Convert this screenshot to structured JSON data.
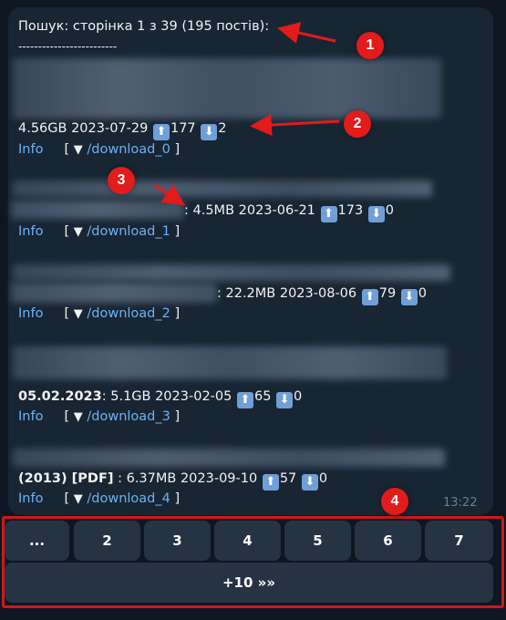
{
  "message": {
    "header": "Пошук: сторінка 1 з 39 (195 постів):",
    "separator": "-------------------------",
    "time": "13:22",
    "download_prefix": "[",
    "download_suffix": "]",
    "triangle": "▼",
    "up_icon": "⬆",
    "down_icon": "⬇",
    "posts": [
      {
        "prefix": "",
        "bold": "",
        "meta": "4.56GB  2023-07-29",
        "up": "177",
        "down": "2",
        "info": "Info",
        "download": "/download_0"
      },
      {
        "prefix": "",
        "bold": "",
        "meta": ": 4.5MB  2023-06-21",
        "up": "173",
        "down": "0",
        "info": "Info",
        "download": "/download_1"
      },
      {
        "prefix": "",
        "bold": "",
        "meta": ": 22.2MB  2023-08-06",
        "up": "79",
        "down": "0",
        "info": "Info",
        "download": "/download_2"
      },
      {
        "prefix": "",
        "bold": "05.02.2023",
        "meta": ": 5.1GB  2023-02-05",
        "up": "65",
        "down": "0",
        "info": "Info",
        "download": "/download_3"
      },
      {
        "prefix": "",
        "bold": "(2013) [PDF]",
        "meta": " : 6.37MB  2023-09-10",
        "up": "57",
        "down": "0",
        "info": "Info",
        "download": "/download_4"
      }
    ]
  },
  "keyboard": {
    "row1": [
      "...",
      "2",
      "3",
      "4",
      "5",
      "6",
      "7"
    ],
    "row2": [
      "+10 »»"
    ]
  },
  "annotations": [
    "1",
    "2",
    "3",
    "4"
  ],
  "colors": {
    "background": "#0e1621",
    "bubble": "#182533",
    "link": "#6ab3f3",
    "button": "#253343",
    "annotation": "#e21b1b"
  }
}
